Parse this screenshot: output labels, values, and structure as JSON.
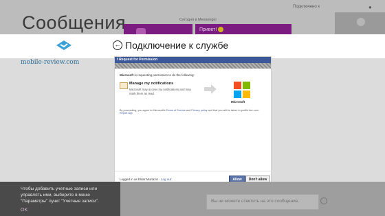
{
  "background": {
    "title": "Сообщения",
    "status": "Подключено к",
    "conversation_meta": "Сегодня в Messenger",
    "message": "Привет!"
  },
  "band": {
    "title": "Подключение к службе"
  },
  "watermark": {
    "text": "mobile-review.com"
  },
  "panel": {
    "header": "Request for Permission",
    "request_app": "Microsoft",
    "request_rest": " is requesting permission to do the following:",
    "permission_title": "Manage my notifications",
    "permission_desc": "Microsoft may access my notifications and may mark them as read.",
    "app_name": "Microsoft",
    "terms_prefix": "By proceeding, you agree to Microsoft's ",
    "terms_link": "Terms of Service",
    "terms_and": " and ",
    "privacy_link": "Privacy policy",
    "terms_suffix": " and that you will be taken to profile.live.com · ",
    "report_link": "Report app",
    "logged_in": "Logged in as Eldar Murtazin · ",
    "logout": "Log out",
    "allow": "Allow",
    "dont_allow": "Don't allow"
  },
  "bottom": {
    "notice": "Чтобы добавить учетные записи или управлять ими, выберите в меню \"Параметры\" пункт \"Учетные записи\".",
    "ok": "OK",
    "reply_placeholder": "Вы не можете ответить на это сообщение."
  },
  "colors": {
    "facebook_blue": "#3b5998",
    "messaging_purple": "#7a1c80"
  }
}
